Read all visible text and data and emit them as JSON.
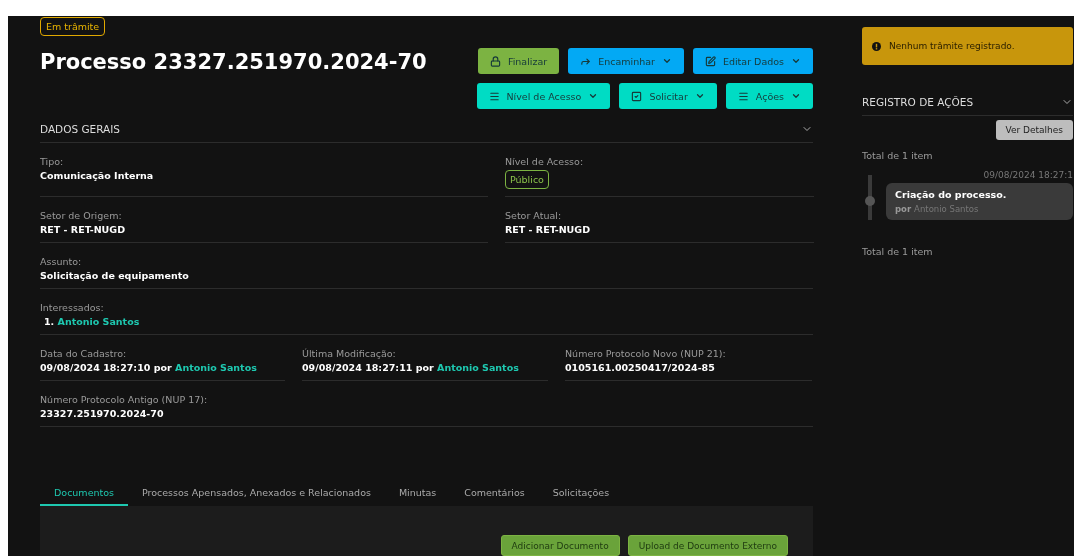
{
  "status_badge": "Em trâmite",
  "title": "Processo 23327.251970.2024-70",
  "action_rows": [
    {
      "buttons": [
        {
          "label": "Finalizar",
          "dropdown": false
        },
        {
          "label": "Encaminhar",
          "dropdown": true
        },
        {
          "label": "Editar Dados",
          "dropdown": true
        }
      ]
    },
    {
      "buttons": [
        {
          "label": "Nível de Acesso",
          "dropdown": true
        },
        {
          "label": "Solicitar",
          "dropdown": true
        },
        {
          "label": "Ações",
          "dropdown": true
        }
      ]
    }
  ],
  "section": {
    "title": "DADOS GERAIS",
    "expanded": true
  },
  "field_rows": [
    {
      "cells": [
        {
          "label": "Tipo:",
          "kind": "text",
          "value": "Comunicação Interna"
        },
        {
          "label": "Nível de Acesso:",
          "kind": "badge",
          "value": "Público"
        }
      ]
    },
    {
      "cells": [
        {
          "label": "Setor de Origem:",
          "kind": "text",
          "value": "RET - RET-NUGD"
        },
        {
          "label": "Setor Atual:",
          "kind": "text",
          "value": "RET - RET-NUGD"
        }
      ]
    },
    {
      "cells": [
        {
          "label": "Assunto:",
          "kind": "text",
          "value": "Solicitação de equipamento"
        }
      ]
    },
    {
      "cells": [
        {
          "label": "Interessados:",
          "kind": "list",
          "items": [
            {
              "number": "1.",
              "name": "Antonio Santos"
            }
          ]
        }
      ]
    },
    {
      "cells": [
        {
          "label": "Data do Cadastro:",
          "kind": "by",
          "value": "09/08/2024 18:27:10",
          "by": "por",
          "user": "Antonio Santos"
        },
        {
          "label": "Última Modificação:",
          "kind": "by",
          "value": "09/08/2024 18:27:11",
          "by": "por",
          "user": "Antonio Santos"
        },
        {
          "label": "Número Protocolo Novo (NUP 21):",
          "kind": "text",
          "value": "0105161.00250417/2024-85"
        }
      ]
    },
    {
      "cells": [
        {
          "label": "Número Protocolo Antigo (NUP 17):",
          "kind": "text",
          "value": "23327.251970.2024-70"
        }
      ]
    }
  ],
  "tabs": [
    {
      "label": "Documentos",
      "selected": true
    },
    {
      "label": "Processos Apensados, Anexados e Relacionados",
      "selected": false
    },
    {
      "label": "Minutas",
      "selected": false
    },
    {
      "label": "Comentários",
      "selected": false
    },
    {
      "label": "Solicitações",
      "selected": false
    }
  ],
  "document_buttons": [
    "Adicionar Documento",
    "Upload de Documento Externo"
  ],
  "sidebar": {
    "notice": "Nenhum trâmite registrado.",
    "log_title": "REGISTRO DE AÇÕES",
    "details_button": "Ver Detalhes",
    "total_top": "Total de 1 item",
    "total_bottom": "Total de 1 item",
    "entries": [
      {
        "date": "09/08/2024 18:27:1",
        "title": "Criação do processo.",
        "by": "por",
        "user": "Antonio Santos"
      }
    ]
  }
}
